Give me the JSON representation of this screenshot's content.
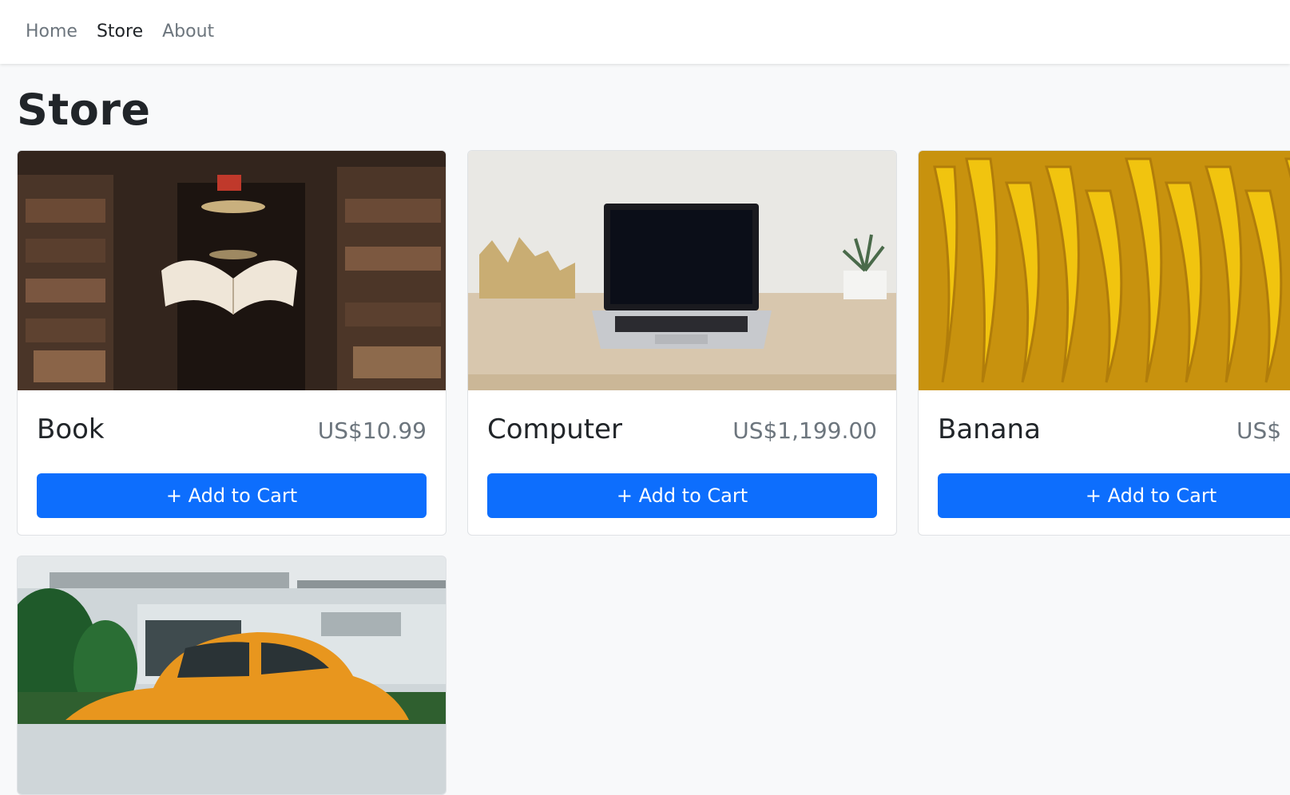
{
  "nav": {
    "items": [
      "Home",
      "Store",
      "About"
    ],
    "active": "Store"
  },
  "page": {
    "title": "Store"
  },
  "accent_color": "#0d6efd",
  "products": [
    {
      "name": "Book",
      "price": "US$10.99",
      "button": "+ Add to Cart"
    },
    {
      "name": "Computer",
      "price": "US$1,199.00",
      "button": "+ Add to Cart"
    },
    {
      "name": "Banana",
      "price": "US$",
      "button": "+ Add to Cart"
    },
    {
      "name": "",
      "price": "",
      "button": ""
    }
  ]
}
